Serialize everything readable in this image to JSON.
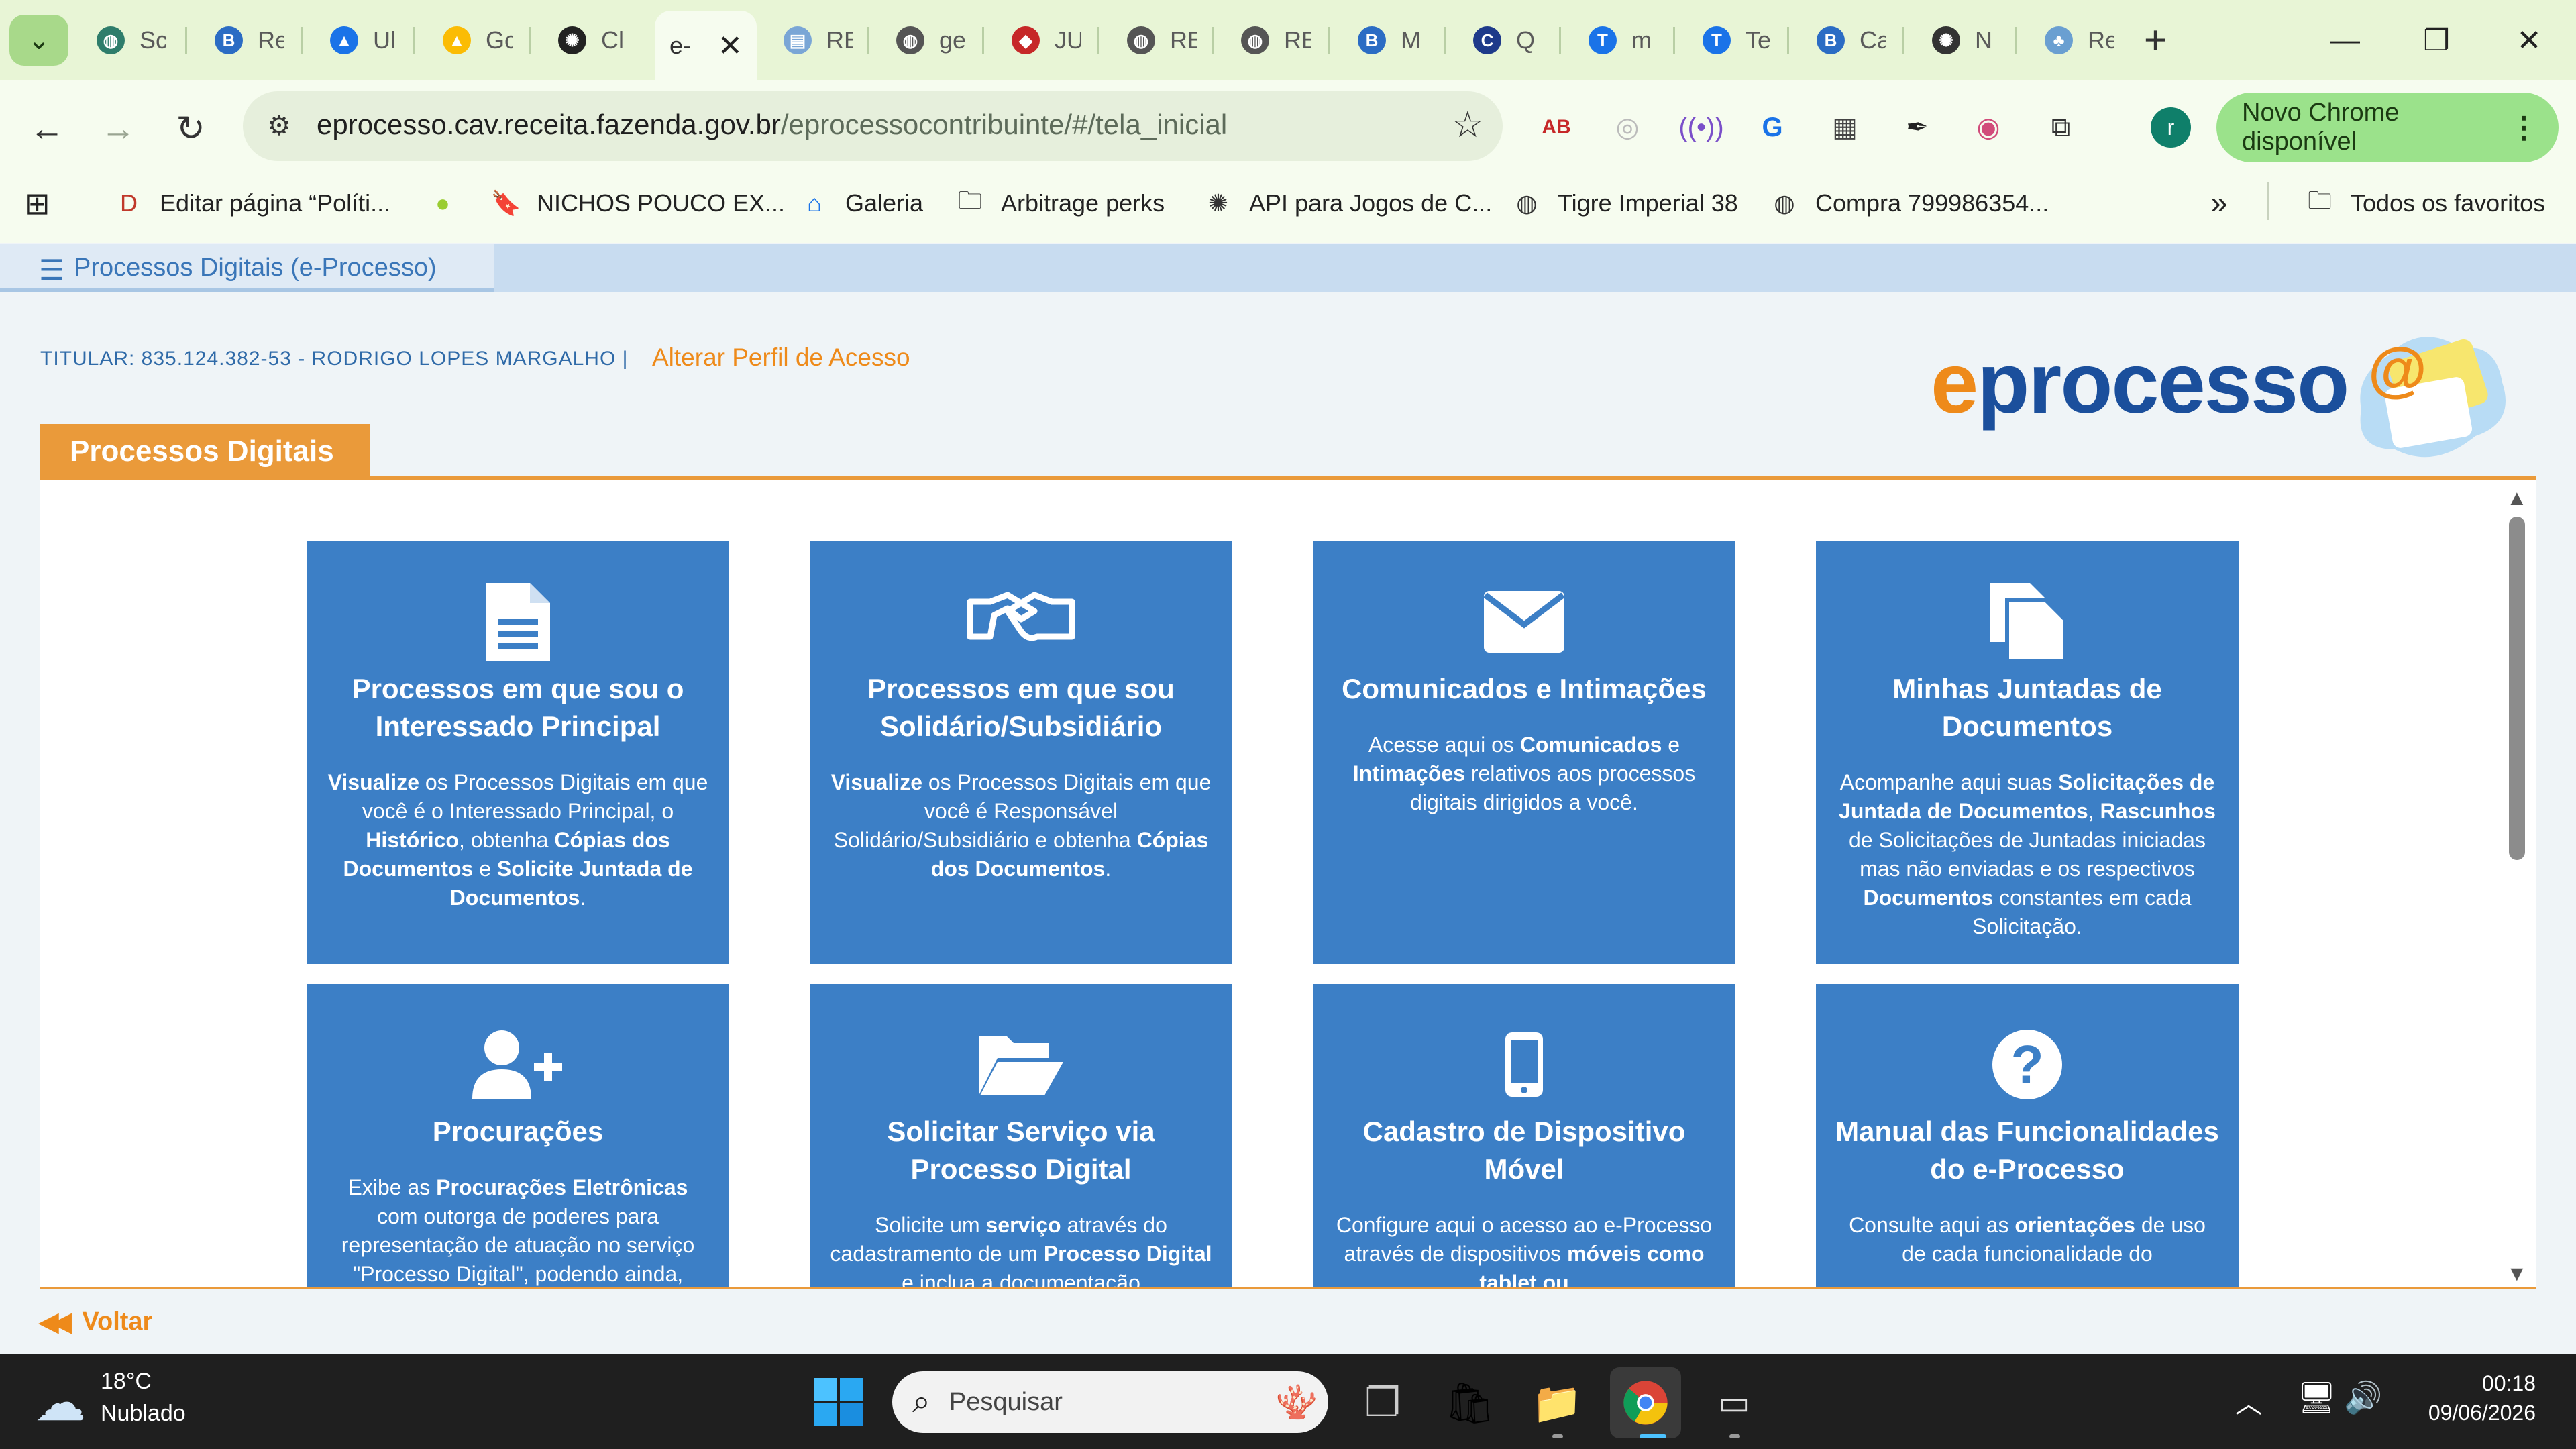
{
  "browser": {
    "tabs": [
      {
        "title": "Sc",
        "icon": "globe-icon",
        "color": "#2e7d6b"
      },
      {
        "title": "Re",
        "icon": "b-logo-icon",
        "color": "#2b6cc4"
      },
      {
        "title": "Ul",
        "icon": "drive-icon",
        "color": "#1a73e8"
      },
      {
        "title": "Gc",
        "icon": "drive-icon",
        "color": "#fbbc04"
      },
      {
        "title": "Cl",
        "icon": "openai-icon",
        "color": "#222222"
      },
      {
        "title": "RE",
        "icon": "doc-icon",
        "color": "#7aa6d6"
      },
      {
        "title": "ge",
        "icon": "globe-icon",
        "color": "#555555"
      },
      {
        "title": "JU",
        "icon": "diamond-icon",
        "color": "#c62828"
      },
      {
        "title": "RE",
        "icon": "globe-icon",
        "color": "#555555"
      },
      {
        "title": "RE",
        "icon": "globe-icon",
        "color": "#555555"
      },
      {
        "title": "M",
        "icon": "b-logo-icon",
        "color": "#2b6cc4"
      },
      {
        "title": "Q",
        "icon": "c-logo-icon",
        "color": "#1e3a8a"
      },
      {
        "title": "m",
        "icon": "t-logo-icon",
        "color": "#1a73e8"
      },
      {
        "title": "Te",
        "icon": "t-logo-icon",
        "color": "#1a73e8"
      },
      {
        "title": "Ca",
        "icon": "b-logo-icon",
        "color": "#2b6cc4"
      },
      {
        "title": "N",
        "icon": "openai-icon",
        "color": "#333333"
      },
      {
        "title": "Re",
        "icon": "tree-icon",
        "color": "#6a9fd1"
      }
    ],
    "active_tab": {
      "title": "e-"
    },
    "url_host": "eprocesso.cav.receita.fazenda.gov.br",
    "url_path": "/eprocessocontribuinte/#/tela_inicial",
    "update_label": "Novo Chrome disponível",
    "profile_initial": "r",
    "bookmarks": [
      {
        "label": "Editar página “Políti...",
        "icon": "ds-icon"
      },
      {
        "label": "",
        "icon": "dot-icon"
      },
      {
        "label": "NICHOS POUCO EX...",
        "icon": "bookmark-icon"
      },
      {
        "label": "Galeria",
        "icon": "home-icon"
      },
      {
        "label": "Arbitrage perks",
        "icon": "folder-icon"
      },
      {
        "label": "API para Jogos de C...",
        "icon": "openai-icon"
      },
      {
        "label": "Tigre Imperial 38",
        "icon": "globe-icon"
      },
      {
        "label": "Compra 799986354...",
        "icon": "globe-icon"
      }
    ],
    "all_bookmarks_label": "Todos os favoritos"
  },
  "app": {
    "title": "Processos Digitais (e-Processo)",
    "titular": "TITULAR: 835.124.382-53 - RODRIGO LOPES MARGALHO |",
    "alterar_perfil": "Alterar Perfil de Acesso",
    "logo_text": "processo",
    "logo_e": "e",
    "section_title": "Processos Digitais",
    "voltar": "Voltar",
    "cards": [
      {
        "icon": "document-icon",
        "title": "Processos em que sou o Interessado Principal",
        "parts": [
          [
            "b",
            "Visualize"
          ],
          [
            "t",
            " os Processos Digitais em que você é o Interessado Principal, o "
          ],
          [
            "b",
            "Histórico"
          ],
          [
            "t",
            ", obtenha "
          ],
          [
            "b",
            "Cópias dos Documentos"
          ],
          [
            "t",
            " e "
          ],
          [
            "b",
            "Solicite Juntada de Documentos"
          ],
          [
            "t",
            "."
          ]
        ]
      },
      {
        "icon": "handshake-icon",
        "title": "Processos em que sou Solidário/Subsidiário",
        "parts": [
          [
            "b",
            "Visualize"
          ],
          [
            "t",
            " os Processos Digitais em que você é Responsável Solidário/Subsidiário e obtenha "
          ],
          [
            "b",
            "Cópias dos Documentos"
          ],
          [
            "t",
            "."
          ]
        ]
      },
      {
        "icon": "envelope-icon",
        "title": "Comunicados e Intimações",
        "parts": [
          [
            "t",
            "Acesse aqui os "
          ],
          [
            "b",
            "Comunicados"
          ],
          [
            "t",
            " e "
          ],
          [
            "b",
            "Intimações"
          ],
          [
            "t",
            " relativos aos processos digitais dirigidos a você."
          ]
        ]
      },
      {
        "icon": "files-icon",
        "title": "Minhas Juntadas de Documentos",
        "parts": [
          [
            "t",
            "Acompanhe aqui suas "
          ],
          [
            "b",
            "Solicitações de Juntada de Documentos"
          ],
          [
            "t",
            ", "
          ],
          [
            "b",
            "Rascunhos"
          ],
          [
            "t",
            " de Solicitações de Juntadas iniciadas mas não enviadas e os respectivos "
          ],
          [
            "b",
            "Documentos"
          ],
          [
            "t",
            " constantes em cada Solicitação."
          ]
        ]
      },
      {
        "icon": "user-plus-icon",
        "title": "Procurações",
        "parts": [
          [
            "t",
            "Exibe as "
          ],
          [
            "b",
            "Procurações Eletrônicas"
          ],
          [
            "t",
            " com outorga de poderes para representação de atuação no serviço \"Processo Digital\", podendo ainda,"
          ]
        ]
      },
      {
        "icon": "folder-open-icon",
        "title": "Solicitar Serviço via Processo Digital",
        "parts": [
          [
            "t",
            "Solicite um "
          ],
          [
            "b",
            "serviço"
          ],
          [
            "t",
            " através do cadastramento de um "
          ],
          [
            "b",
            "Processo Digital"
          ],
          [
            "t",
            " e inclua a documentação"
          ]
        ]
      },
      {
        "icon": "mobile-icon",
        "title": "Cadastro de Dispositivo Móvel",
        "parts": [
          [
            "t",
            "Configure aqui o acesso ao e-Processo através de dispositivos "
          ],
          [
            "b",
            "móveis como tablet ou"
          ]
        ]
      },
      {
        "icon": "question-icon",
        "title": "Manual das Funcionalidades do e-Processo",
        "parts": [
          [
            "t",
            "Consulte aqui as "
          ],
          [
            "b",
            "orientações"
          ],
          [
            "t",
            " de uso de cada funcionalidade do"
          ]
        ]
      }
    ]
  },
  "taskbar": {
    "temperature": "18°C",
    "weather": "Nublado",
    "search_placeholder": "Pesquisar",
    "time": "00:18",
    "date": "09/06/2026"
  }
}
